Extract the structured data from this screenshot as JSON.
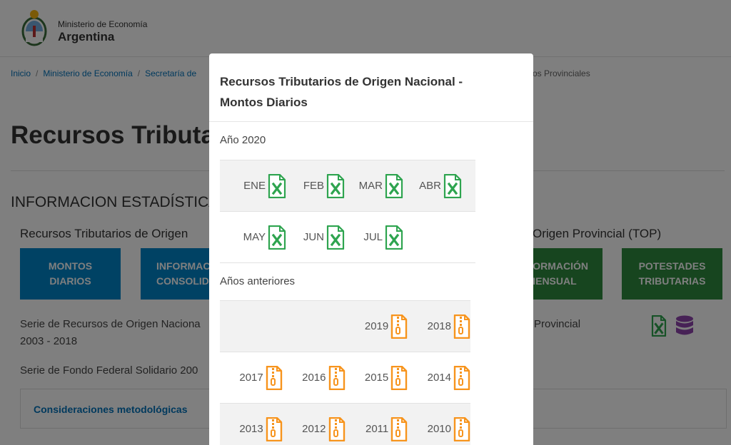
{
  "header": {
    "ministry_top": "Ministerio de Economía",
    "ministry_main": "Argentina"
  },
  "breadcrumb": {
    "items": [
      "Inicio",
      "Ministerio de Economía",
      "Secretaría de"
    ],
    "tail": "os Provinciales"
  },
  "page": {
    "title": "Recursos Tributa",
    "section_heading": "INFORMACION ESTADÍSTICA",
    "subtitle_left": "Recursos Tributarios de Origen",
    "subtitle_right": "Origen Provincial (TOP)",
    "buttons": {
      "montos_line1": "MONTOS",
      "montos_line2": "DIARIOS",
      "informacion_line1": "INFORMAC",
      "informacion_line2": "CONSOLIDA",
      "mensual_line1": "ORMACIÓN",
      "mensual_line2": "IENSUAL",
      "potestades_line1": "POTESTADES",
      "potestades_line2": "TRIBUTARIAS"
    },
    "desc_series_line1": "Serie de Recursos de Origen Naciona",
    "desc_series_line2": "2003 - 2018",
    "desc_fondo": "Serie de Fondo Federal Solidario 200",
    "desc_provincial": "Provincial",
    "considerations_link": "Consideraciones metodológicas"
  },
  "modal": {
    "title": "Recursos Tributarios de Origen Nacional - Montos Diarios",
    "year_label": "Año 2020",
    "months": [
      [
        "ENE",
        "FEB",
        "MAR",
        "ABR"
      ],
      [
        "MAY",
        "JUN",
        "JUL"
      ]
    ],
    "previous_label": "Años anteriores",
    "previous_years": [
      [
        "",
        "",
        "2019",
        "2018"
      ],
      [
        "2017",
        "2016",
        "2015",
        "2014"
      ],
      [
        "2013",
        "2012",
        "2011",
        "2010"
      ]
    ]
  },
  "colors": {
    "excel_green": "#2ea44f",
    "zip_orange": "#f7941d",
    "button_blue": "#0085c8",
    "button_green": "#2e8b3e",
    "link_blue": "#0072bb",
    "database_purple": "#8e44ad"
  },
  "icons": {
    "excel": "excel-file-icon",
    "zip": "zip-file-icon",
    "database": "database-icon",
    "logo": "argentina-coat-of-arms"
  }
}
